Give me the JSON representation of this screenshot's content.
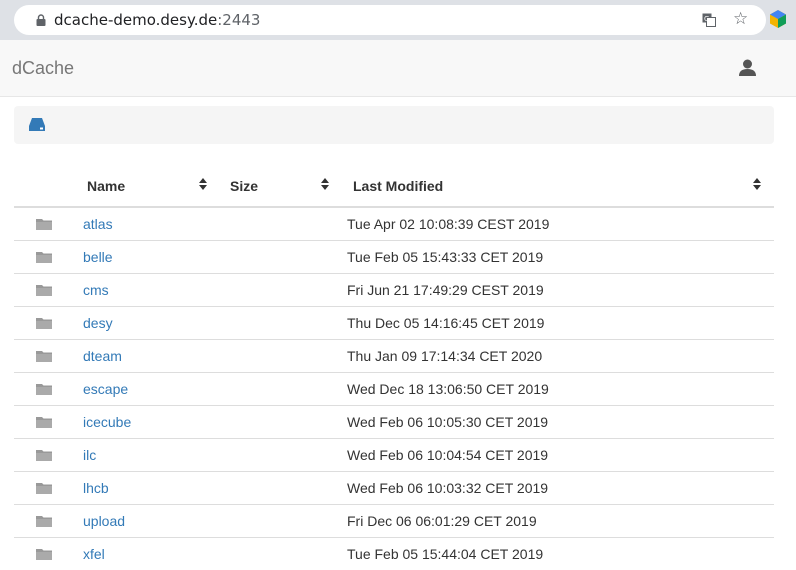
{
  "browser": {
    "url_host": "dcache-demo.desy.de",
    "url_port": ":2443"
  },
  "navbar": {
    "brand": "dCache"
  },
  "table": {
    "headers": {
      "name": "Name",
      "size": "Size",
      "modified": "Last Modified"
    },
    "rows": [
      {
        "name": "atlas",
        "size": "",
        "modified": "Tue Apr 02 10:08:39 CEST 2019"
      },
      {
        "name": "belle",
        "size": "",
        "modified": "Tue Feb 05 15:43:33 CET 2019"
      },
      {
        "name": "cms",
        "size": "",
        "modified": "Fri Jun 21 17:49:29 CEST 2019"
      },
      {
        "name": "desy",
        "size": "",
        "modified": "Thu Dec 05 14:16:45 CET 2019"
      },
      {
        "name": "dteam",
        "size": "",
        "modified": "Thu Jan 09 17:14:34 CET 2020"
      },
      {
        "name": "escape",
        "size": "",
        "modified": "Wed Dec 18 13:06:50 CET 2019"
      },
      {
        "name": "icecube",
        "size": "",
        "modified": "Wed Feb 06 10:05:30 CET 2019"
      },
      {
        "name": "ilc",
        "size": "",
        "modified": "Wed Feb 06 10:04:54 CET 2019"
      },
      {
        "name": "lhcb",
        "size": "",
        "modified": "Wed Feb 06 10:03:32 CET 2019"
      },
      {
        "name": "upload",
        "size": "",
        "modified": "Fri Dec 06 06:01:29 CET 2019"
      },
      {
        "name": "xfel",
        "size": "",
        "modified": "Tue Feb 05 15:44:04 CET 2019"
      }
    ]
  },
  "colors": {
    "link": "#337ab7",
    "drive_icon": "#337ab7",
    "folder_icon": "#999999"
  },
  "icons": [
    "lock-icon",
    "translate-icon",
    "star-icon",
    "extension-icon",
    "user-icon",
    "drive-icon",
    "sort-icon",
    "folder-icon"
  ]
}
